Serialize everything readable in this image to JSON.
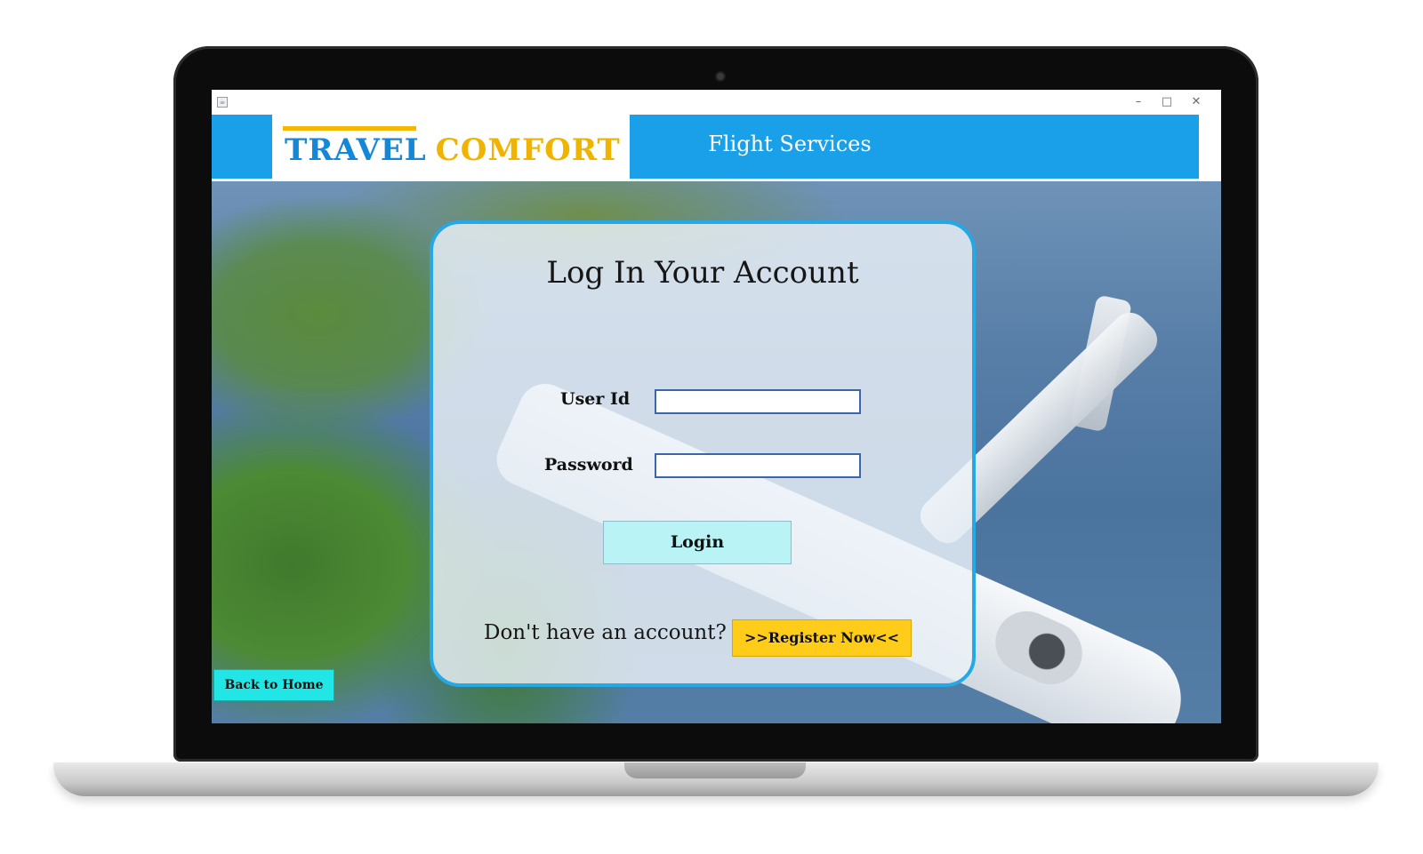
{
  "window": {
    "minimize_glyph": "–",
    "maximize_glyph": "□",
    "close_glyph": "✕"
  },
  "header": {
    "brand_travel": "TRAVEL",
    "brand_comfort": "COMFORT",
    "title": "Flight Services"
  },
  "login": {
    "title": "Log In Your Account",
    "user_label": "User Id",
    "user_value": "",
    "password_label": "Password",
    "password_value": "",
    "login_button": "Login",
    "no_account_text": "Don't have an account?",
    "register_button": ">>Register Now<<"
  },
  "footer": {
    "back_button": "Back to Home"
  },
  "colors": {
    "header_blue": "#1aa0e8",
    "brand_blue": "#1487d6",
    "brand_gold": "#f0b400",
    "card_border": "#25a8e6",
    "login_button_bg": "#b9f3f5",
    "register_button_bg": "#ffcc1a",
    "back_button_bg": "#22e6e6"
  },
  "icons": {
    "app": "java-app-icon"
  }
}
